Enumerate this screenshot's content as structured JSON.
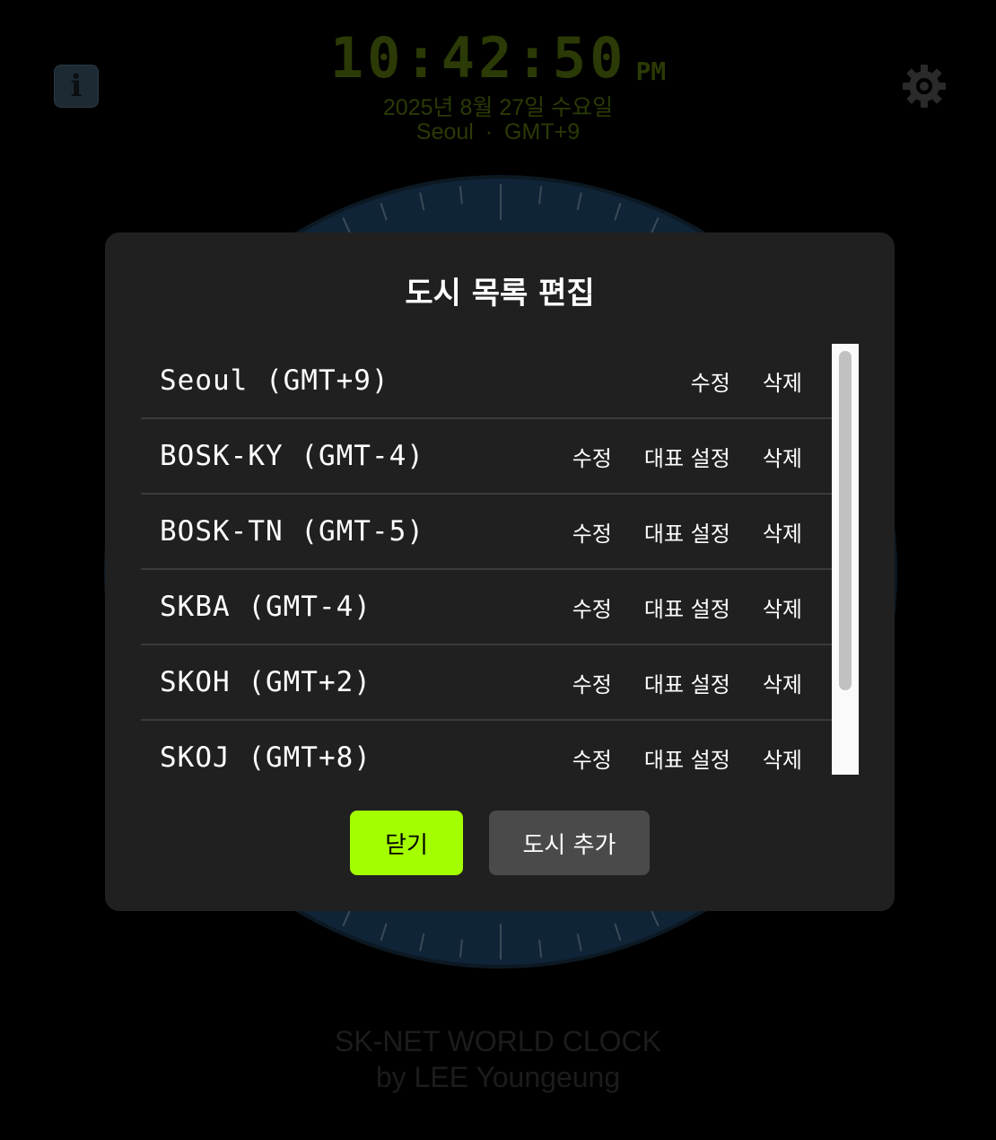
{
  "clock": {
    "time": "10:42:50",
    "ampm": "PM",
    "date": "2025년 8월 27일 수요일",
    "location": "Seoul · GMT+9"
  },
  "header": {
    "info_label": "i",
    "info_icon": "info-icon",
    "settings_icon": "gear-icon"
  },
  "footer": {
    "line1": "SK-NET WORLD CLOCK",
    "line2": "by LEE Youngeung"
  },
  "modal": {
    "title": "도시 목록 편집",
    "cities": [
      {
        "name": "Seoul (GMT+9)",
        "edit": "수정",
        "set_primary": "",
        "delete": "삭제"
      },
      {
        "name": "BOSK-KY (GMT-4)",
        "edit": "수정",
        "set_primary": "대표 설정",
        "delete": "삭제"
      },
      {
        "name": "BOSK-TN (GMT-5)",
        "edit": "수정",
        "set_primary": "대표 설정",
        "delete": "삭제"
      },
      {
        "name": "SKBA (GMT-4)",
        "edit": "수정",
        "set_primary": "대표 설정",
        "delete": "삭제"
      },
      {
        "name": "SKOH (GMT+2)",
        "edit": "수정",
        "set_primary": "대표 설정",
        "delete": "삭제"
      },
      {
        "name": "SKOJ (GMT+8)",
        "edit": "수정",
        "set_primary": "대표 설정",
        "delete": "삭제"
      }
    ],
    "close_label": "닫기",
    "add_label": "도시 추가"
  },
  "colors": {
    "accent": "#a3ff00",
    "modal_bg": "#202020",
    "secondary_button": "#4a4a4a",
    "dial_fill": "#0f2436"
  }
}
